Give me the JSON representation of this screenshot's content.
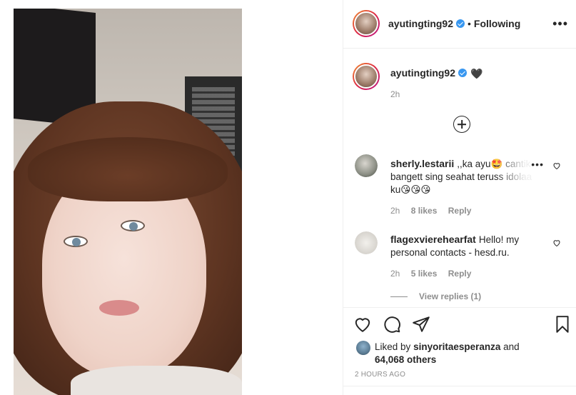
{
  "post": {
    "author": "ayutingting92",
    "following_label": "Following",
    "more_label": "•••"
  },
  "caption": {
    "username": "ayutingting92",
    "text": "🖤",
    "time": "2h"
  },
  "comments": [
    {
      "username": "sherly.lestarii",
      "text": ",,ka ayu🤩 cantik bangett sing seahat teruss idolaa ku😘😘😘",
      "time": "2h",
      "likes": "8 likes",
      "reply_label": "Reply"
    },
    {
      "username": "flagexvierehearfat",
      "text": "Hello! my personal contacts - hesd.ru.",
      "time": "2h",
      "likes": "5 likes",
      "reply_label": "Reply",
      "view_replies": "View replies (1)"
    }
  ],
  "likes_line": {
    "prefix": "Liked by",
    "user": "sinyoritaesperanza",
    "connector": "and",
    "others": "64,068 others"
  },
  "posted_ago": "2 HOURS AGO",
  "icons": {
    "like": "heart-icon",
    "comment": "comment-icon",
    "share": "paper-plane-icon",
    "save": "bookmark-icon",
    "add_comment": "plus-circle-icon",
    "verified": "verified-badge-icon"
  },
  "colors": {
    "verified": "#3897f0",
    "text": "#262626",
    "muted": "#8e8e8e",
    "border": "#efefef"
  }
}
